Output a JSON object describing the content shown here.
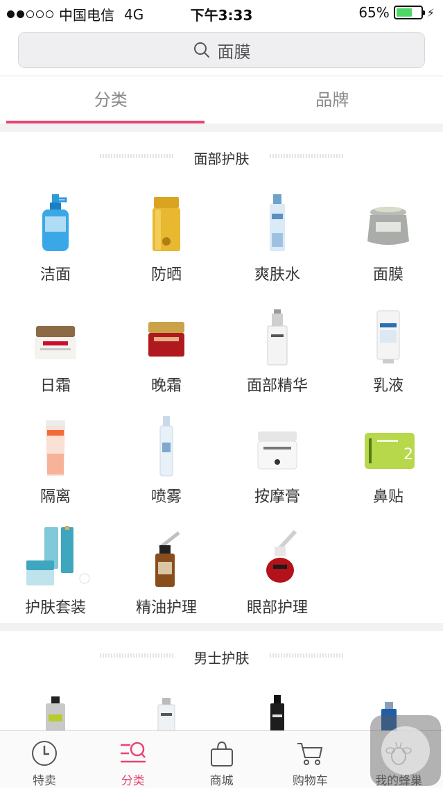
{
  "status_bar": {
    "carrier": "中国电信",
    "network": "4G",
    "time": "下午3:33",
    "battery": "65%"
  },
  "search": {
    "text": "面膜"
  },
  "tabs": [
    {
      "label": "分类"
    },
    {
      "label": "品牌"
    }
  ],
  "sections": [
    {
      "title": "面部护肤",
      "items": [
        {
          "label": "洁面",
          "icon": "cleanser-bottle-icon"
        },
        {
          "label": "防晒",
          "icon": "sunscreen-bottle-icon"
        },
        {
          "label": "爽肤水",
          "icon": "toner-bottle-icon"
        },
        {
          "label": "面膜",
          "icon": "mask-jar-icon"
        },
        {
          "label": "日霜",
          "icon": "day-cream-jar-icon"
        },
        {
          "label": "晚霜",
          "icon": "night-cream-jar-icon"
        },
        {
          "label": "面部精华",
          "icon": "serum-pump-icon"
        },
        {
          "label": "乳液",
          "icon": "lotion-tube-icon"
        },
        {
          "label": "隔离",
          "icon": "primer-tube-icon"
        },
        {
          "label": "喷雾",
          "icon": "spray-bottle-icon"
        },
        {
          "label": "按摩膏",
          "icon": "massage-gel-jar-icon"
        },
        {
          "label": "鼻贴",
          "icon": "nose-strip-pack-icon"
        },
        {
          "label": "护肤套装",
          "icon": "skincare-set-icon"
        },
        {
          "label": "精油护理",
          "icon": "dropper-oil-bottle-icon"
        },
        {
          "label": "眼部护理",
          "icon": "eye-serum-dropper-icon"
        }
      ]
    },
    {
      "title": "男士护肤",
      "items": [
        {
          "icon": "men-cleanser-bottle-icon"
        },
        {
          "icon": "men-toner-bottle-icon"
        },
        {
          "icon": "men-serum-bottle-icon"
        },
        {
          "icon": "men-lotion-bottle-icon"
        }
      ]
    }
  ],
  "tab_bar": [
    {
      "label": "特卖",
      "icon": "clock-icon"
    },
    {
      "label": "分类",
      "icon": "category-search-icon"
    },
    {
      "label": "商城",
      "icon": "shopping-bag-icon"
    },
    {
      "label": "购物车",
      "icon": "cart-icon"
    },
    {
      "label": "我的蜂巢",
      "icon": "bee-profile-icon"
    }
  ],
  "colors": {
    "accent": "#e94471",
    "background": "#ffffff",
    "divider": "#f2f2f2"
  }
}
